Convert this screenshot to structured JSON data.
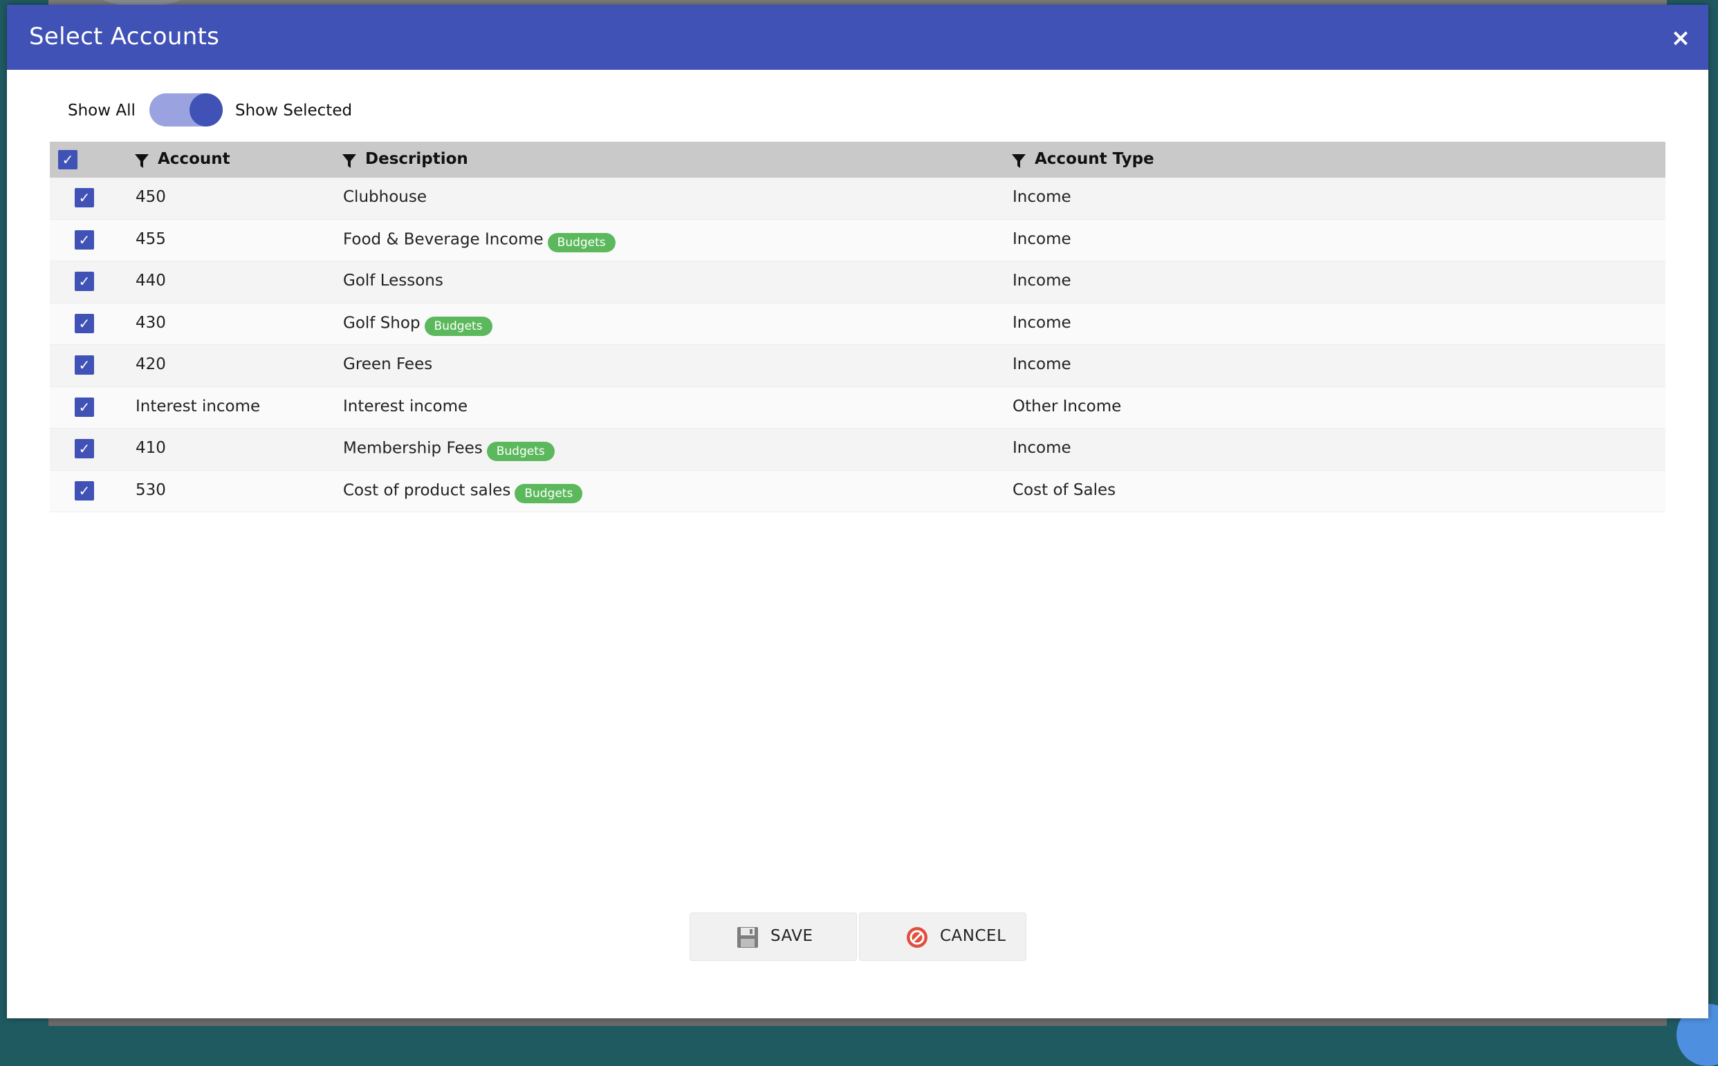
{
  "dialog": {
    "title": "Select Accounts",
    "close_label": "×"
  },
  "toggle": {
    "left_label": "Show All",
    "right_label": "Show Selected",
    "state": "show-selected"
  },
  "table": {
    "columns": {
      "account": "Account",
      "description": "Description",
      "account_type": "Account Type"
    },
    "check_mark": "✓",
    "rows": [
      {
        "account": "450",
        "description": "Clubhouse",
        "badge": "",
        "account_type": "Income",
        "checked": true
      },
      {
        "account": "455",
        "description": "Food & Beverage Income",
        "badge": "Budgets",
        "account_type": "Income",
        "checked": true
      },
      {
        "account": "440",
        "description": "Golf Lessons",
        "badge": "",
        "account_type": "Income",
        "checked": true
      },
      {
        "account": "430",
        "description": "Golf Shop",
        "badge": "Budgets",
        "account_type": "Income",
        "checked": true
      },
      {
        "account": "420",
        "description": "Green Fees",
        "badge": "",
        "account_type": "Income",
        "checked": true
      },
      {
        "account": "Interest income",
        "description": "Interest income",
        "badge": "",
        "account_type": "Other Income",
        "checked": true
      },
      {
        "account": "410",
        "description": "Membership Fees",
        "badge": "Budgets",
        "account_type": "Income",
        "checked": true
      },
      {
        "account": "530",
        "description": "Cost of product sales",
        "badge": "Budgets",
        "account_type": "Cost of Sales",
        "checked": true
      }
    ]
  },
  "buttons": {
    "save_label": "SAVE",
    "cancel_label": "CANCEL"
  },
  "icons": {
    "close": "close-icon",
    "filter": "filter-icon",
    "checkbox": "checkbox-checked-icon",
    "save": "floppy-disk-icon",
    "cancel": "cancel-circle-icon"
  },
  "colors": {
    "header": "#4052b5",
    "badge": "#5cb85c",
    "toggle_track": "#9aa3df"
  }
}
